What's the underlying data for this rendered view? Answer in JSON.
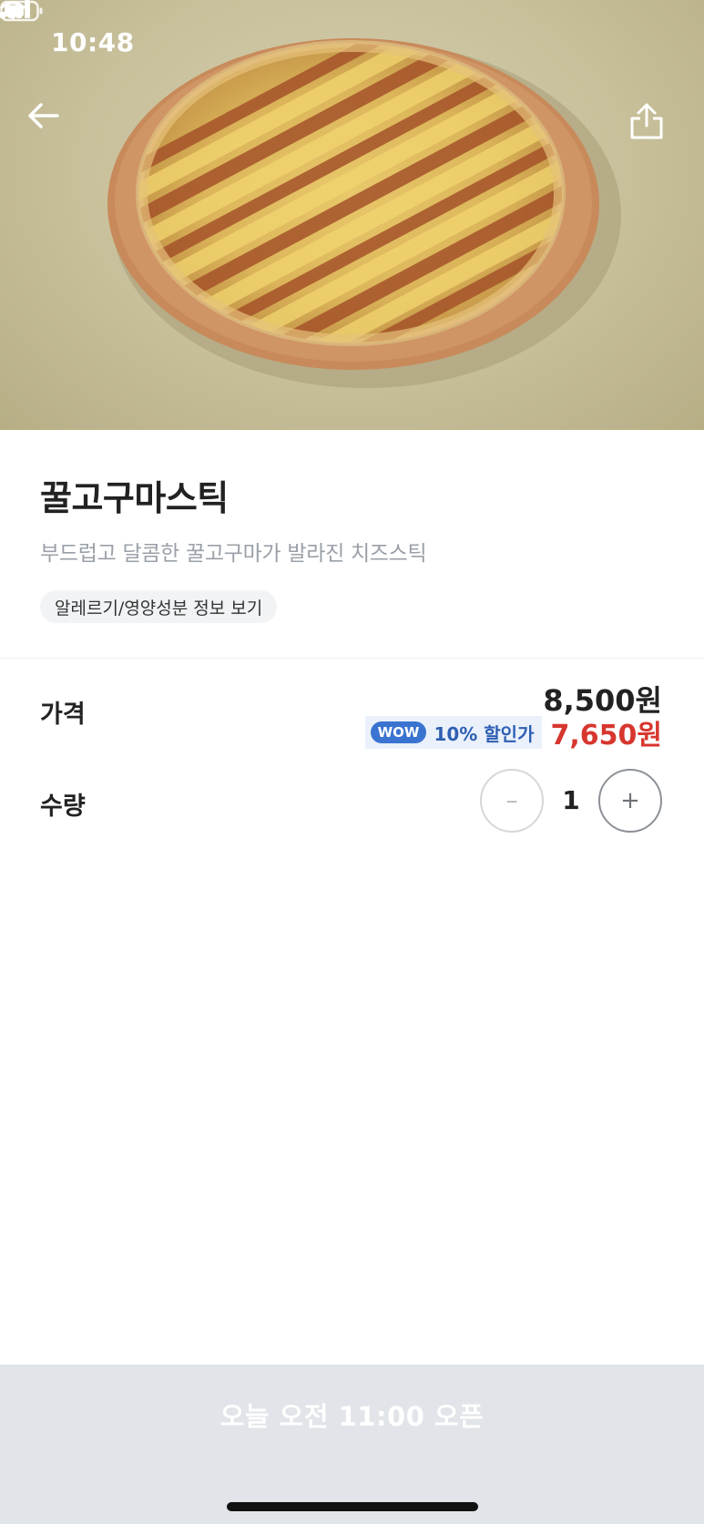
{
  "status_bar": {
    "time": "10:48"
  },
  "hero": {
    "image": "pizza-cheese-stick-photo"
  },
  "product": {
    "name": "꿀고구마스틱",
    "description": "부드럽고 달콤한 꿀고구마가 발라진 치즈스틱",
    "allergy_chip": "알레르기/영양성분 정보 보기"
  },
  "price": {
    "label": "가격",
    "original": "8,500원",
    "wow_badge": "WOW",
    "discount_text": "10% 할인가",
    "sale": "7,650원"
  },
  "quantity": {
    "label": "수량",
    "minus": "–",
    "value": "1",
    "plus": "+"
  },
  "bottom": {
    "button_label": "오늘 오전 11:00 오픈"
  },
  "colors": {
    "accent_blue": "#3b73d1",
    "sale_red": "#d7362e",
    "bottom_bar": "#e1e4e8"
  }
}
